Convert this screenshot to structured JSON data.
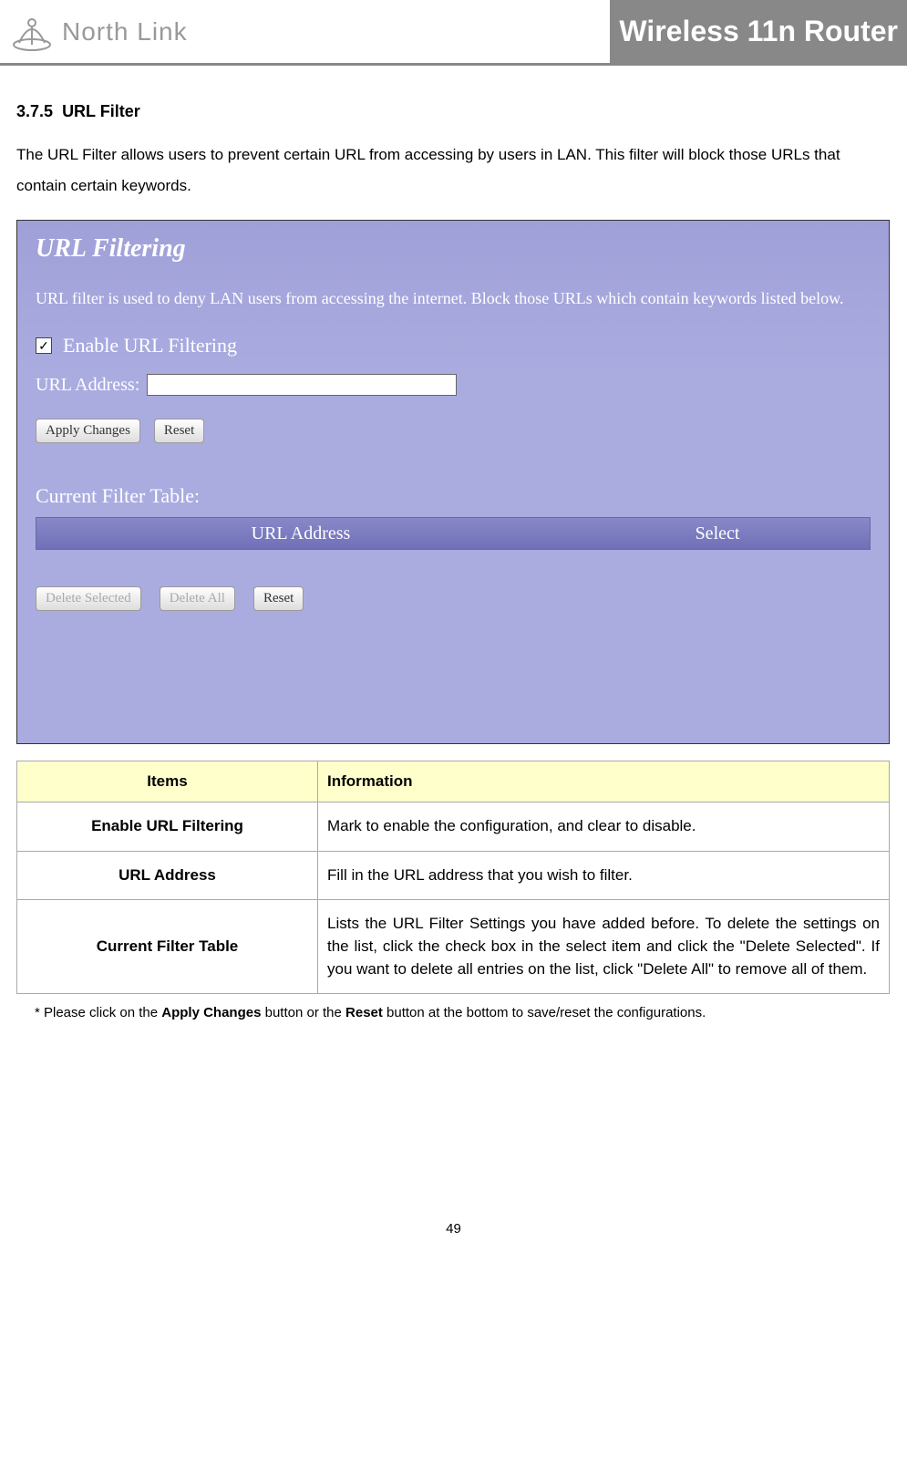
{
  "header": {
    "logo_text": "North Link",
    "page_title": "Wireless 11n Router"
  },
  "section": {
    "number": "3.7.5",
    "title": "URL Filter",
    "intro": "The URL Filter allows users to prevent certain URL from accessing by users in LAN. This filter will block those URLs that contain certain keywords."
  },
  "screenshot": {
    "title": "URL Filtering",
    "desc": "URL filter is used to deny LAN users from accessing the internet. Block those URLs which contain keywords listed below.",
    "enable_label": "Enable URL Filtering",
    "url_address_label": "URL Address:",
    "apply_btn": "Apply Changes",
    "reset_btn": "Reset",
    "table_title": "Current Filter Table:",
    "th_url": "URL Address",
    "th_select": "Select",
    "delete_selected_btn": "Delete Selected",
    "delete_all_btn": "Delete All",
    "reset_btn2": "Reset"
  },
  "table": {
    "header_items": "Items",
    "header_info": "Information",
    "rows": [
      {
        "item": "Enable URL Filtering",
        "info": "Mark to enable the configuration, and clear to disable."
      },
      {
        "item": "URL Address",
        "info": "Fill in the URL address that you wish to filter."
      },
      {
        "item": "Current Filter Table",
        "info": "Lists the URL Filter Settings you have added before. To delete the settings on the list, click the check box in the select item and click the \"Delete Selected\". If you want to delete all entries on the list, click \"Delete All\" to remove all of them."
      }
    ]
  },
  "footnote": {
    "prefix": "* Please click on the ",
    "bold1": "Apply Changes",
    "mid": " button or the ",
    "bold2": "Reset",
    "suffix": " button at the bottom to save/reset the configurations."
  },
  "page_number": "49"
}
